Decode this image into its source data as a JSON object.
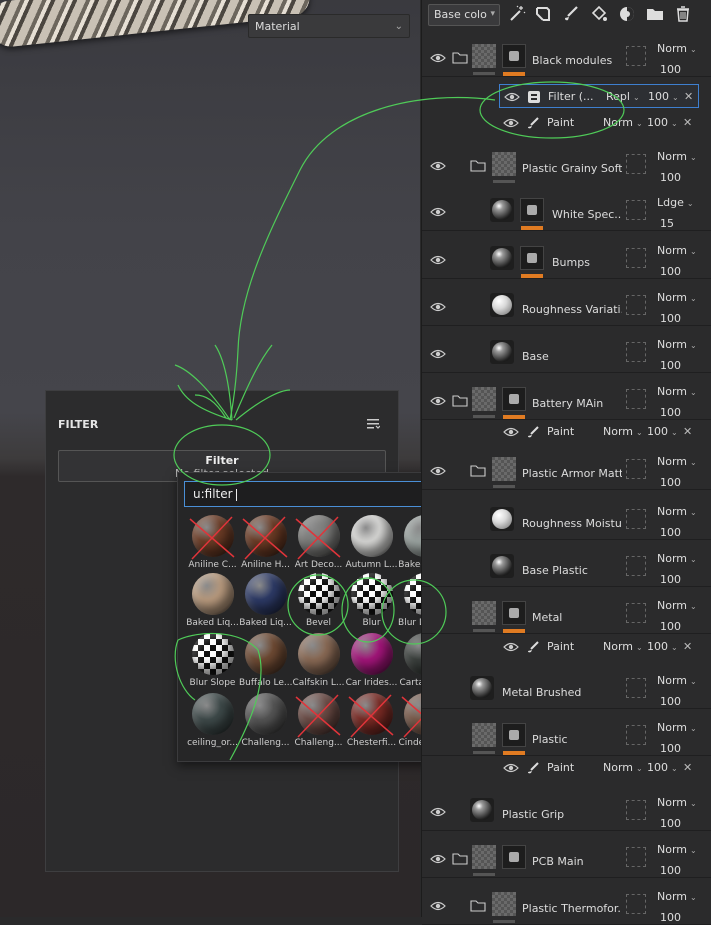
{
  "viewport": {
    "material_select": "Material"
  },
  "filter_panel": {
    "title": "FILTER",
    "slot_title": "Filter",
    "slot_status": "No filter selected"
  },
  "popup": {
    "search_value": "u:filter",
    "items": [
      {
        "label": "Aniline C...",
        "color": "#6b3b25",
        "crossed": true
      },
      {
        "label": "Aniline H...",
        "color": "#6a3a24",
        "crossed": true
      },
      {
        "label": "Art Deco...",
        "color": "#7a7a78",
        "crossed": true
      },
      {
        "label": "Autumn L...",
        "color": "#d7d7d5",
        "crossed": false
      },
      {
        "label": "Baked Liq...",
        "color": "#9aa3a0",
        "crossed": false
      },
      {
        "label": "Baked Liq...",
        "color": "#b89a7e",
        "crossed": false
      },
      {
        "label": "Baked Liq...",
        "color": "#2d3a66",
        "crossed": false
      },
      {
        "label": "Bevel",
        "color": "checker",
        "crossed": false
      },
      {
        "label": "Blur",
        "color": "checker",
        "crossed": false
      },
      {
        "label": "Blur Direc...",
        "color": "checker",
        "crossed": false
      },
      {
        "label": "Blur Slope",
        "color": "checker",
        "crossed": false
      },
      {
        "label": "Buffalo Le...",
        "color": "#6e4a33",
        "crossed": false
      },
      {
        "label": "Calfskin L...",
        "color": "#8a6a55",
        "crossed": false
      },
      {
        "label": "Car Irides...",
        "color": "#a3157a",
        "crossed": false
      },
      {
        "label": "Cartagen...",
        "color": "#3a3f3c",
        "crossed": false
      },
      {
        "label": "ceiling_or...",
        "color": "#3e4a4a",
        "crossed": false
      },
      {
        "label": "Challeng...",
        "color": "#555555",
        "crossed": false
      },
      {
        "label": "Challeng...",
        "color": "#6a4a44",
        "crossed": true
      },
      {
        "label": "Chesterfi...",
        "color": "#7a2a24",
        "crossed": true
      },
      {
        "label": "CinderBlo...",
        "color": "#7a5a4a",
        "crossed": true
      }
    ]
  },
  "layers": {
    "channel_select": "Base colo",
    "toolbar_icons": [
      "magic-wand-icon",
      "smart-material-icon",
      "brush-icon",
      "fill-icon",
      "effects-icon",
      "folder-icon",
      "trash-icon"
    ],
    "rows": [
      {
        "name": "Black modules",
        "blend": "Norm",
        "opacity": "100",
        "kind": "folder-mask",
        "eye": true,
        "folder": true,
        "orange": true
      },
      {
        "name": "Plastic Grainy Soft",
        "blend": "Norm",
        "opacity": "100",
        "kind": "folder-plain",
        "eye": true,
        "folder": true,
        "orange": false
      },
      {
        "name": "White Spec...",
        "blend": "Ldge",
        "opacity": "15",
        "kind": "sphere-mask",
        "eye": true,
        "folder": false,
        "orange": true
      },
      {
        "name": "Bumps",
        "blend": "Norm",
        "opacity": "100",
        "kind": "sphere-mask",
        "eye": true,
        "folder": false,
        "orange": true
      },
      {
        "name": "Roughness Variati...",
        "blend": "Norm",
        "opacity": "100",
        "kind": "sphere-light",
        "eye": true,
        "folder": false,
        "orange": false
      },
      {
        "name": "Base",
        "blend": "Norm",
        "opacity": "100",
        "kind": "sphere",
        "eye": true,
        "folder": false,
        "orange": false
      },
      {
        "name": "Battery MAin",
        "blend": "Norm",
        "opacity": "100",
        "kind": "folder-mask",
        "eye": true,
        "folder": true,
        "orange": true
      },
      {
        "name": "Plastic Armor Matte",
        "blend": "Norm",
        "opacity": "100",
        "kind": "folder-plain",
        "eye": true,
        "folder": true,
        "orange": false
      },
      {
        "name": "Roughness Moisture",
        "blend": "Norm",
        "opacity": "100",
        "kind": "sphere-light",
        "eye": false,
        "folder": false,
        "orange": false
      },
      {
        "name": "Base Plastic",
        "blend": "Norm",
        "opacity": "100",
        "kind": "sphere",
        "eye": false,
        "folder": false,
        "orange": false
      },
      {
        "name": "Metal",
        "blend": "Norm",
        "opacity": "100",
        "kind": "check-mask",
        "eye": false,
        "folder": false,
        "orange": true
      },
      {
        "name": "Metal Brushed",
        "blend": "Norm",
        "opacity": "100",
        "kind": "sphere-solo",
        "eye": false,
        "folder": false,
        "orange": false
      },
      {
        "name": "Plastic",
        "blend": "Norm",
        "opacity": "100",
        "kind": "check-mask",
        "eye": false,
        "folder": false,
        "orange": true
      },
      {
        "name": "Plastic Grip",
        "blend": "Norm",
        "opacity": "100",
        "kind": "sphere-solo",
        "eye": true,
        "folder": false,
        "orange": false
      },
      {
        "name": "PCB Main",
        "blend": "Norm",
        "opacity": "100",
        "kind": "folder-mask",
        "eye": true,
        "folder": true,
        "orange": false
      },
      {
        "name": "Plastic Thermofor...",
        "blend": "Norm",
        "opacity": "100",
        "kind": "folder-plain",
        "eye": true,
        "folder": true,
        "orange": false
      }
    ],
    "subrows": {
      "filter": {
        "name": "Filter (...",
        "blend": "Repl",
        "opacity": "100"
      },
      "paint1": {
        "name": "Paint",
        "blend": "Norm",
        "opacity": "100"
      },
      "paint2": {
        "name": "Paint",
        "blend": "Norm",
        "opacity": "100"
      },
      "paint3": {
        "name": "Paint",
        "blend": "Norm",
        "opacity": "100"
      },
      "paint4": {
        "name": "Paint",
        "blend": "Norm",
        "opacity": "100"
      }
    }
  }
}
